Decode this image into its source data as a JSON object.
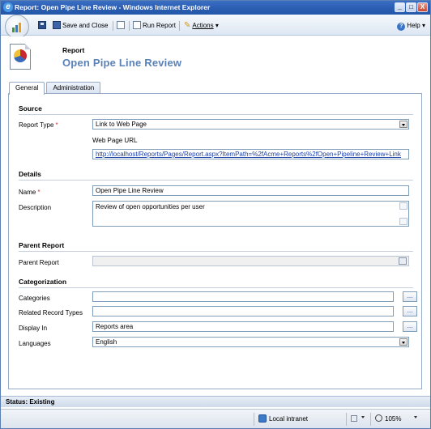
{
  "window": {
    "title": "Report: Open Pipe Line Review - Windows Internet Explorer",
    "controls": [
      "_",
      "□",
      "X"
    ]
  },
  "toolbar": {
    "save_and_close": "Save and Close",
    "run_report": "Run Report",
    "actions": "Actions",
    "help": "Help"
  },
  "header": {
    "entity_type": "Report",
    "entity_name": "Open Pipe Line Review"
  },
  "tabs": [
    {
      "label": "General",
      "active": true
    },
    {
      "label": "Administration",
      "active": false
    }
  ],
  "source": {
    "title": "Source",
    "report_type_label": "Report Type",
    "report_type_value": "Link to Web Page",
    "url_label": "Web Page URL",
    "url_value": "http://localhost/Reports/Pages/Report.aspx?ItemPath=%2fAcme+Reports%2fOpen+Pipeline+Review+Link"
  },
  "details": {
    "title": "Details",
    "name_label": "Name",
    "name_value": "Open Pipe Line Review",
    "description_label": "Description",
    "description_value": "Review of open opportunities per user"
  },
  "parent": {
    "title": "Parent Report",
    "parent_label": "Parent Report",
    "parent_value": ""
  },
  "categorization": {
    "title": "Categorization",
    "categories_label": "Categories",
    "categories_value": "",
    "related_label": "Related Record Types",
    "related_value": "",
    "display_in_label": "Display In",
    "display_in_value": "Reports area",
    "languages_label": "Languages",
    "languages_value": "English",
    "ellipsis": "..."
  },
  "status": {
    "text": "Status: Existing"
  },
  "iebar": {
    "zone": "Local intranet",
    "zoom": "105%"
  },
  "colors": {
    "title_bar": "#2a5cb0",
    "entity_name": "#5a82b8",
    "required": "#d0342c",
    "link": "#1a3ea8"
  }
}
